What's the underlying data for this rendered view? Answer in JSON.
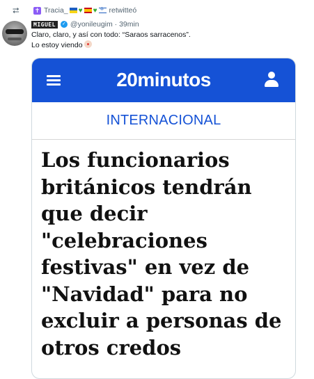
{
  "retweet": {
    "icon": "retweet-icon",
    "user_name": "Tracia_",
    "suffix": "retwitteó"
  },
  "tweet": {
    "display_name": "MIGUEL",
    "handle_time": "@yonileugim · 39min",
    "text_line1": "Claro, claro, y así con todo: “Saraos sarracenos”.",
    "text_line2": "Lo estoy viendo"
  },
  "card": {
    "logo": "20minutos",
    "section": "INTERNACIONAL",
    "headline": "Los funcionarios\nbritánicos tendrán\nque decir\n\"celebraciones\nfestivas\" en vez de\n\"Navidad\" para no\nexcluir a personas de\notros credos",
    "brand_color": "#1552d6"
  }
}
